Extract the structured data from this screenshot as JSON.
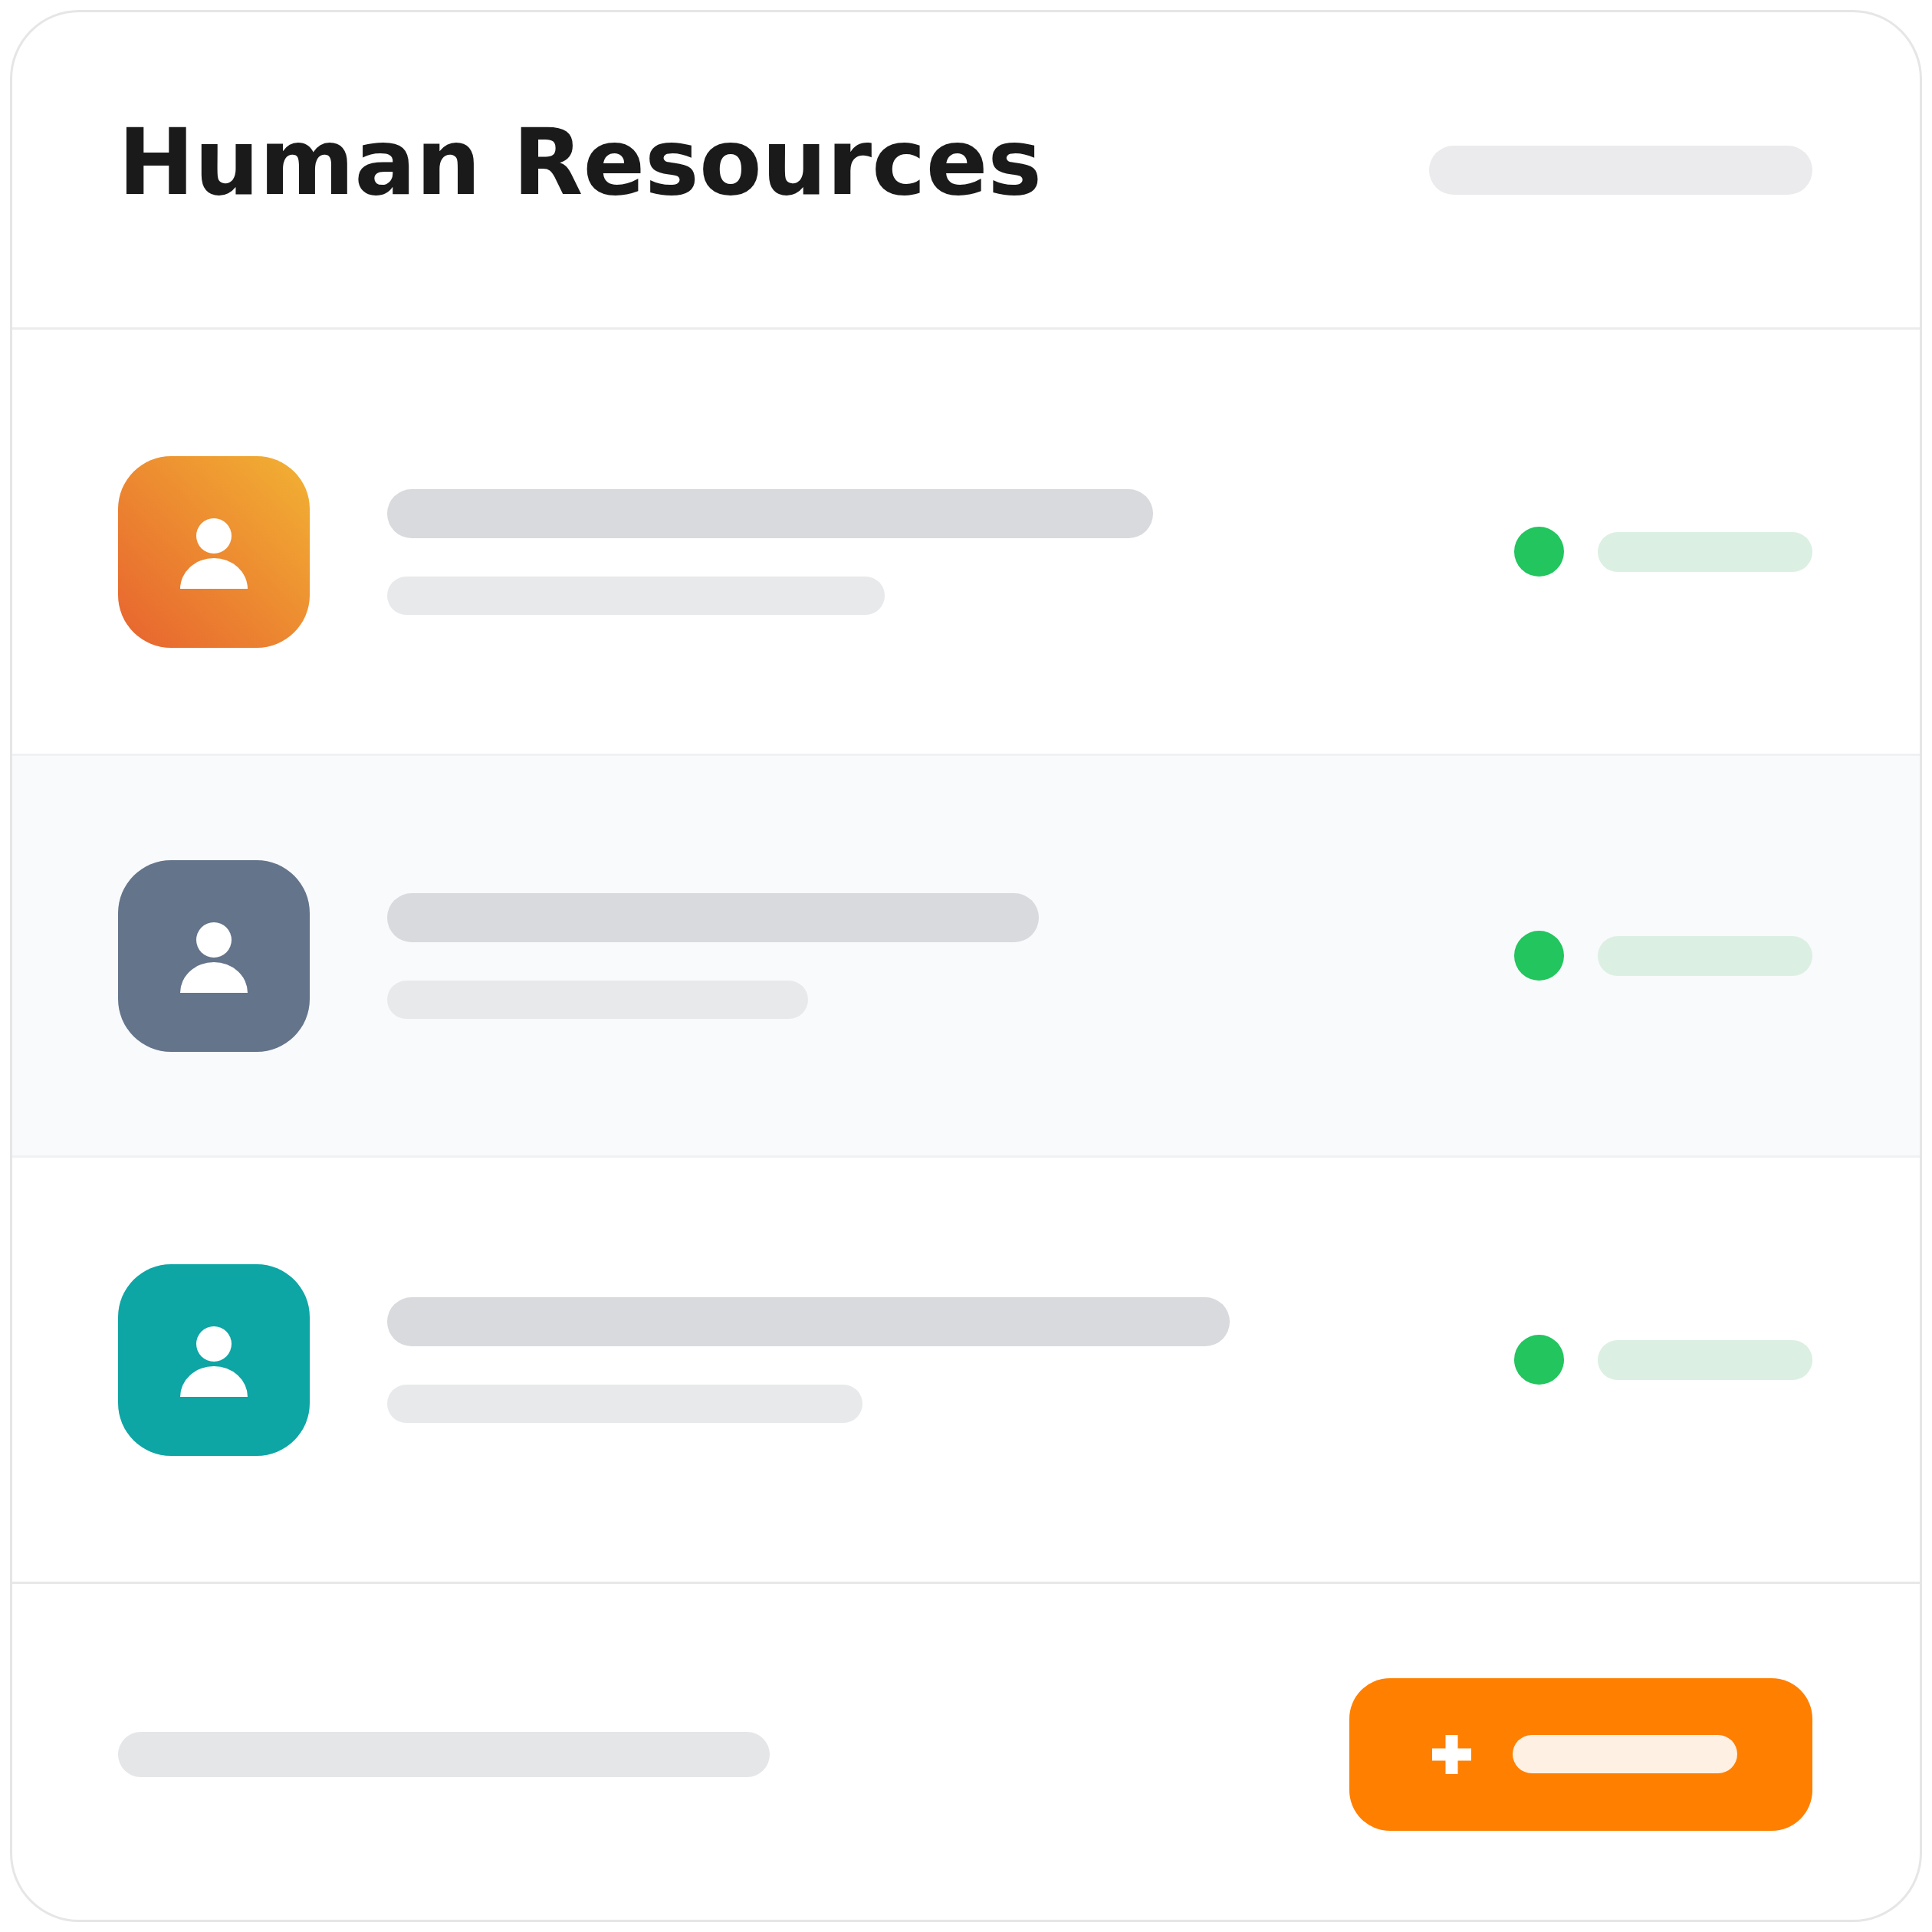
{
  "header": {
    "title": "Human Resources"
  },
  "rows": [
    {
      "selected": false,
      "avatar": {
        "kind": "gradient",
        "color": "#e8692f"
      },
      "status_dot": {
        "color": "#22c55e"
      }
    },
    {
      "selected": true,
      "avatar": {
        "kind": "solid",
        "color": "#64748b"
      },
      "status_dot": {
        "color": "#22c55e"
      }
    },
    {
      "selected": false,
      "avatar": {
        "kind": "solid",
        "color": "#0ea5a5"
      },
      "status_dot": {
        "color": "#22c55e"
      }
    }
  ]
}
